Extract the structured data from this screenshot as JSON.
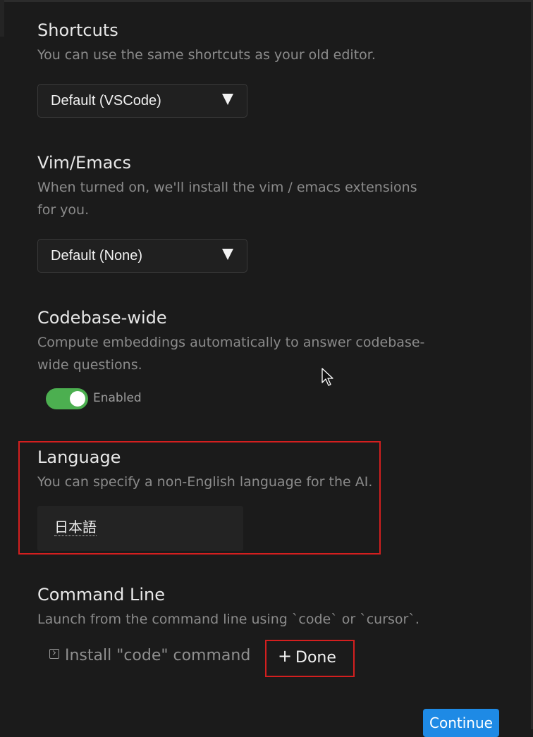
{
  "shortcuts": {
    "title": "Shortcuts",
    "description": "You can use the same shortcuts as your old editor.",
    "selected": "Default (VSCode)"
  },
  "vim_emacs": {
    "title": "Vim/Emacs",
    "description": "When turned on, we'll install the vim / emacs extensions for you.",
    "selected": "Default (None)"
  },
  "codebase": {
    "title": "Codebase-wide",
    "description": "Compute embeddings automatically to answer codebase-wide questions.",
    "toggle_label": "Enabled",
    "toggle_on": true,
    "toggle_color": "#4caf50"
  },
  "language": {
    "title": "Language",
    "description": "You can specify a non-English language for the AI.",
    "value": "日本語"
  },
  "command_line": {
    "title": "Command Line",
    "description": "Launch from the command line using `code` or `cursor`.",
    "install_label": "Install \"code\" command",
    "done_label": "Done",
    "plus_symbol": "+"
  },
  "continue_label": "Continue",
  "icons": {
    "dropdown": "caret-down-icon",
    "terminal": "terminal-icon",
    "plus": "plus-icon",
    "cursor": "mouse-pointer-icon"
  },
  "colors": {
    "background": "#1b1b1b",
    "accent": "#1e8ae5",
    "highlight": "#d41f1f"
  }
}
